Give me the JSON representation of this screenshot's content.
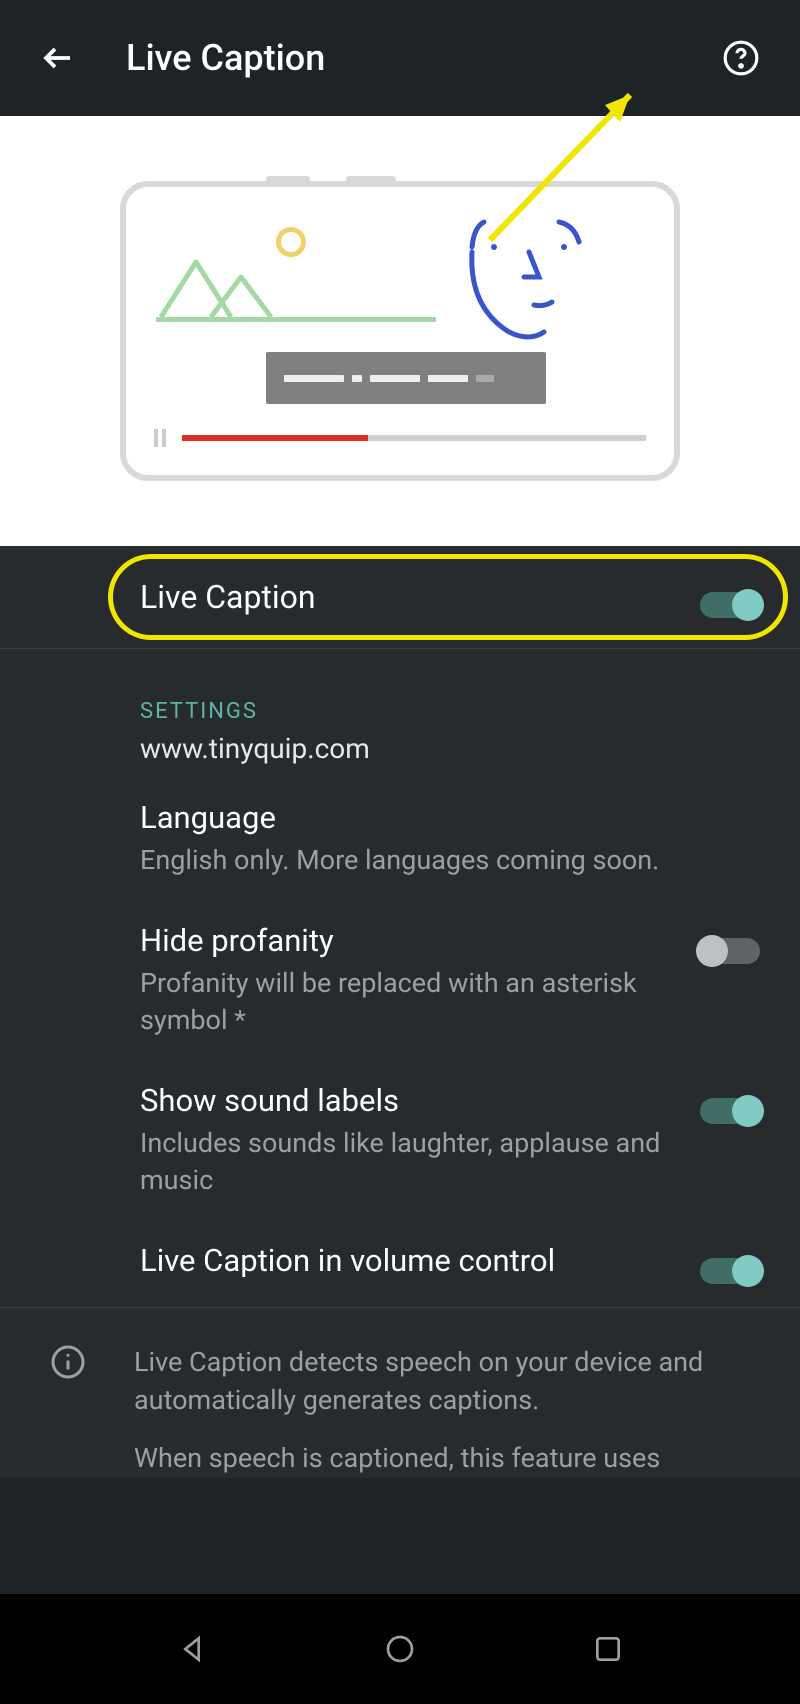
{
  "header": {
    "title": "Live Caption"
  },
  "mainToggle": {
    "label": "Live Caption",
    "on": true
  },
  "sectionLabel": "SETTINGS",
  "watermark": "www.tinyquip.com",
  "settings": [
    {
      "title": "Language",
      "sub": "English only. More languages coming soon.",
      "hasToggle": false
    },
    {
      "title": "Hide profanity",
      "sub": "Profanity will be replaced with an asterisk symbol *",
      "hasToggle": true,
      "on": false
    },
    {
      "title": "Show sound labels",
      "sub": "Includes sounds like laughter, applause and music",
      "hasToggle": true,
      "on": true
    },
    {
      "title": "Live Caption in volume control",
      "sub": "",
      "hasToggle": true,
      "on": true
    }
  ],
  "info": {
    "line1": "Live Caption detects speech on your device and automatically generates captions.",
    "line2": "When speech is captioned, this feature uses"
  }
}
